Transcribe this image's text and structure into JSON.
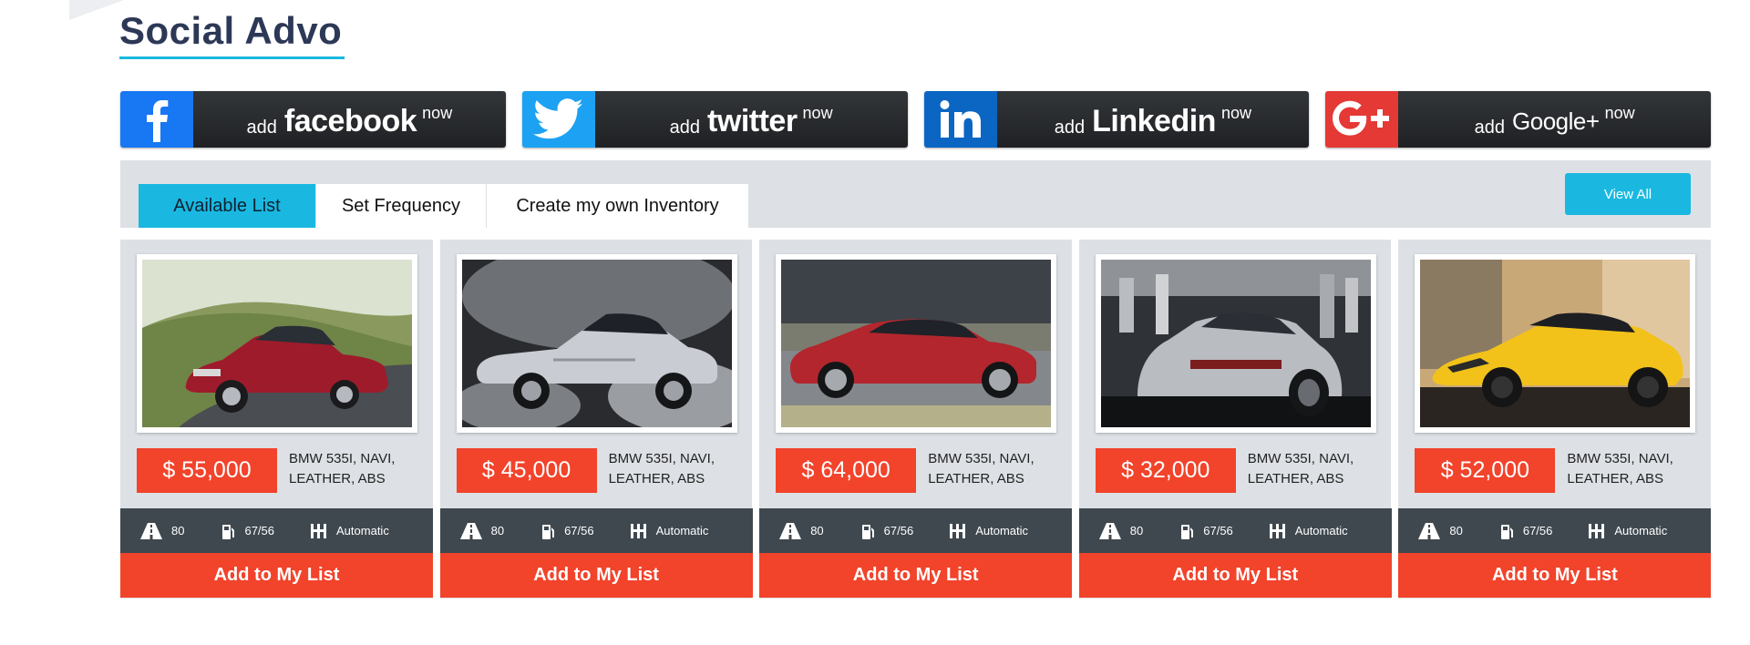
{
  "page_title": "Social Advo",
  "social": [
    {
      "add": "add",
      "brand": "facebook",
      "now": "now",
      "color": "#1877f2",
      "icon": "facebook-icon"
    },
    {
      "add": "add",
      "brand": "twitter",
      "now": "now",
      "color": "#1da1f2",
      "icon": "twitter-bird-icon"
    },
    {
      "add": "add",
      "brand": "Linkedin",
      "now": "now",
      "color": "#0a66c2",
      "icon": "linkedin-icon"
    },
    {
      "add": "add",
      "brand": "Google+",
      "now": "now",
      "color": "#e53935",
      "icon": "google-plus-icon"
    }
  ],
  "tabs": [
    {
      "label": "Available List",
      "active": true
    },
    {
      "label": "Set Frequency",
      "active": false
    },
    {
      "label": "Create my own Inventory",
      "active": false
    }
  ],
  "view_all_label": "View All",
  "cars": [
    {
      "price": "$ 55,000",
      "desc": "BMW 535I, NAVI, LEATHER, ABS",
      "mileage": "80",
      "fuel": "67/56",
      "transmission": "Automatic",
      "button": "Add to My List",
      "photo": "red-sedan-photo"
    },
    {
      "price": "$ 45,000",
      "desc": "BMW 535I, NAVI, LEATHER, ABS",
      "mileage": "80",
      "fuel": "67/56",
      "transmission": "Automatic",
      "button": "Add to My List",
      "photo": "silver-convertible-photo"
    },
    {
      "price": "$ 64,000",
      "desc": "BMW 535I, NAVI, LEATHER, ABS",
      "mileage": "80",
      "fuel": "67/56",
      "transmission": "Automatic",
      "button": "Add to My List",
      "photo": "red-coupe-photo"
    },
    {
      "price": "$ 32,000",
      "desc": "BMW 535I, NAVI, LEATHER, ABS",
      "mileage": "80",
      "fuel": "67/56",
      "transmission": "Automatic",
      "button": "Add to My List",
      "photo": "silver-coupe-photo"
    },
    {
      "price": "$ 52,000",
      "desc": "BMW 535I, NAVI, LEATHER, ABS",
      "mileage": "80",
      "fuel": "67/56",
      "transmission": "Automatic",
      "button": "Add to My List",
      "photo": "yellow-supercar-photo"
    }
  ],
  "colors": {
    "accent": "#1ab8e0",
    "price": "#f2432b",
    "title": "#2d3857",
    "spec_bar": "#3f484f",
    "panel": "#dde1e5"
  }
}
